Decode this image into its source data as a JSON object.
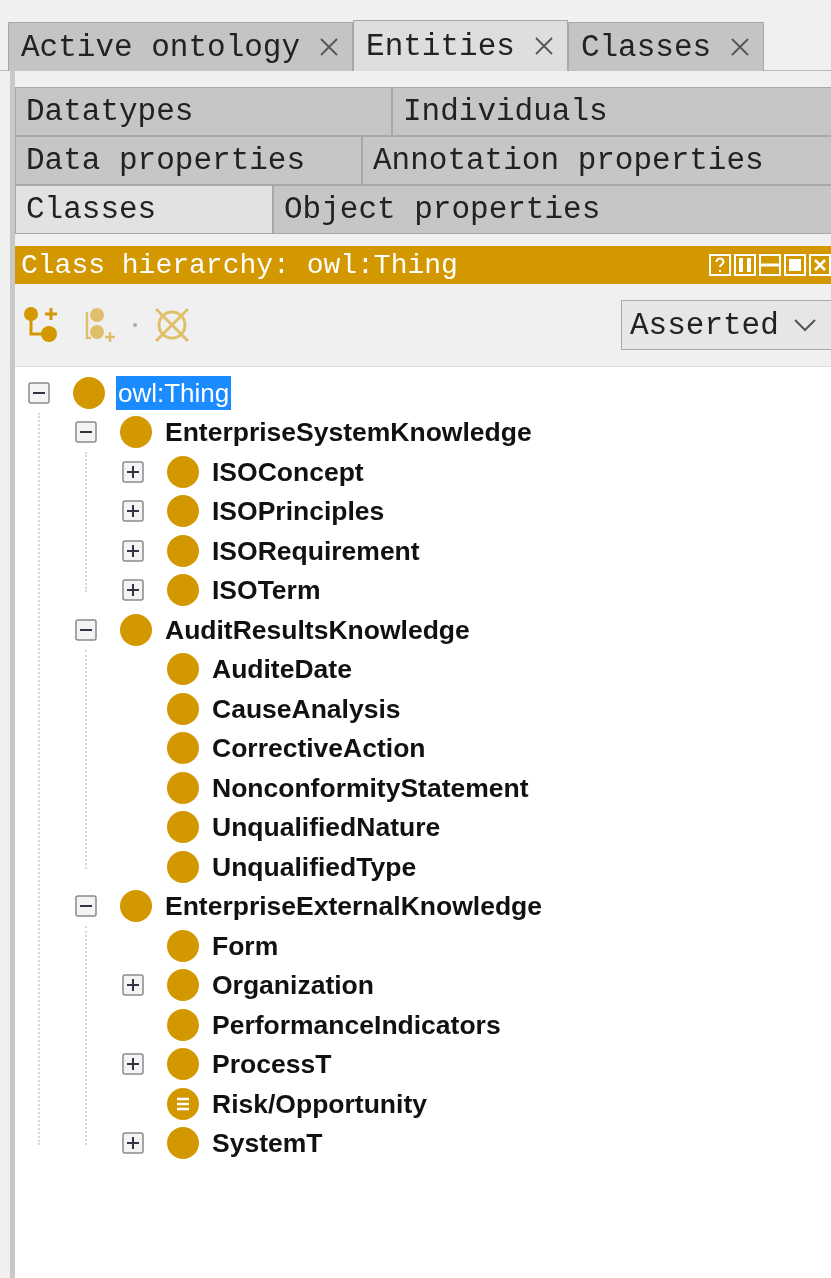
{
  "tabs": [
    {
      "label": "Active ontology",
      "selected": false
    },
    {
      "label": "Entities",
      "selected": true
    },
    {
      "label": "Classes",
      "selected": false
    }
  ],
  "entity_tabs": [
    [
      {
        "label": "Datatypes",
        "selected": false
      },
      {
        "label": "Individuals",
        "selected": false
      }
    ],
    [
      {
        "label": "Data properties",
        "selected": false
      },
      {
        "label": "Annotation properties",
        "selected": false
      }
    ],
    [
      {
        "label": "Classes",
        "selected": true
      },
      {
        "label": "Object properties",
        "selected": false
      }
    ]
  ],
  "view": {
    "title": "Class hierarchy: owl:Thing",
    "mode": "Asserted"
  },
  "tree": [
    {
      "label": "owl:Thing",
      "kind": "class",
      "selected": true,
      "expanded": true,
      "children": [
        {
          "label": "EnterpriseSystemKnowledge",
          "kind": "class",
          "selected": false,
          "expanded": true,
          "children": [
            {
              "label": "ISOConcept",
              "kind": "class",
              "selected": false,
              "expanded": false
            },
            {
              "label": "ISOPrinciples",
              "kind": "class",
              "selected": false,
              "expanded": false
            },
            {
              "label": "ISORequirement",
              "kind": "class",
              "selected": false,
              "expanded": false
            },
            {
              "label": "ISOTerm",
              "kind": "class",
              "selected": false,
              "expanded": false
            }
          ]
        },
        {
          "label": "AuditResultsKnowledge",
          "kind": "class",
          "selected": false,
          "expanded": true,
          "children": [
            {
              "label": "AuditeDate",
              "kind": "class",
              "selected": false
            },
            {
              "label": "CauseAnalysis",
              "kind": "class",
              "selected": false
            },
            {
              "label": "CorrectiveAction",
              "kind": "class",
              "selected": false
            },
            {
              "label": "NonconformityStatement",
              "kind": "class",
              "selected": false
            },
            {
              "label": "UnqualifiedNature",
              "kind": "class",
              "selected": false
            },
            {
              "label": "UnqualifiedType",
              "kind": "class",
              "selected": false
            }
          ]
        },
        {
          "label": "EnterpriseExternalKnowledge",
          "kind": "class",
          "selected": false,
          "expanded": true,
          "children": [
            {
              "label": "Form",
              "kind": "class",
              "selected": false
            },
            {
              "label": "Organization",
              "kind": "class",
              "selected": false,
              "expanded": false
            },
            {
              "label": "PerformanceIndicators",
              "kind": "class",
              "selected": false
            },
            {
              "label": "ProcessT",
              "kind": "class",
              "selected": false,
              "expanded": false
            },
            {
              "label": "Risk/Opportunity",
              "kind": "defined",
              "selected": false
            },
            {
              "label": "SystemT",
              "kind": "class",
              "selected": false,
              "expanded": false
            }
          ]
        }
      ]
    }
  ]
}
